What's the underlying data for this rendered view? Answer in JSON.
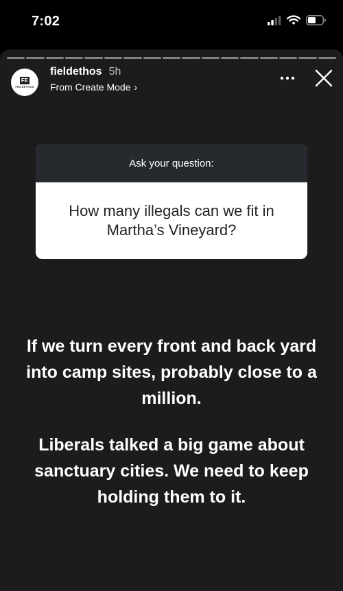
{
  "status_bar": {
    "time": "7:02",
    "icons": [
      "cellular-signal-icon",
      "wifi-icon",
      "battery-icon"
    ]
  },
  "story": {
    "progress_segments": 17,
    "progress_done": 0,
    "account": {
      "avatar_initials": "FE",
      "avatar_brand": "FIELDETHOS",
      "username": "fieldethos",
      "time_ago": "5h",
      "source_label": "From Create Mode",
      "source_chevron": "›"
    },
    "question_sticker": {
      "header": "Ask your question:",
      "question": "How many illegals can we fit in Martha’s Vineyard?"
    },
    "answer": {
      "paragraph1": "If we turn every front and back yard into camp sites, probably close to a million.",
      "paragraph2": "Liberals talked a big game about sanctuary cities. We need to keep holding them to it."
    }
  },
  "colors": {
    "background": "#000000",
    "story_background": "#1c1c1c",
    "sticker_header": "#262a2f",
    "sticker_body": "#ffffff"
  }
}
